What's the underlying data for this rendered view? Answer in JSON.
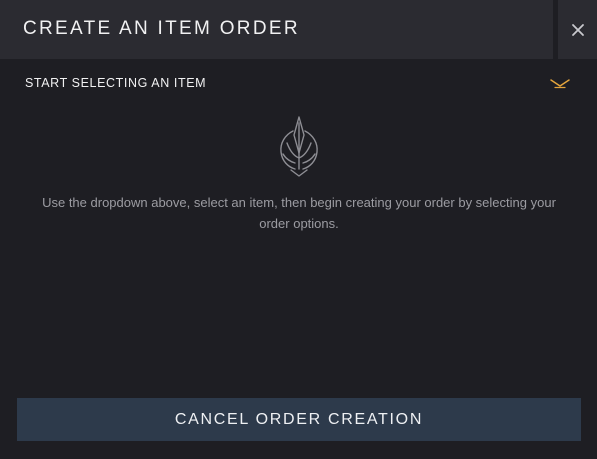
{
  "header": {
    "title": "CREATE AN ITEM ORDER",
    "close_icon": "close-icon"
  },
  "dropdown": {
    "label": "START SELECTING AN ITEM",
    "icon": "chevron-down-icon"
  },
  "empty_state": {
    "icon": "emblem-icon",
    "text": "Use the dropdown above, select an item, then begin creating your order by selecting your order options."
  },
  "footer": {
    "cancel_label": "CANCEL ORDER CREATION"
  },
  "colors": {
    "background": "#1e1e23",
    "header": "#2b2b31",
    "accent": "#e3a43c",
    "button": "#2d3a4b"
  }
}
